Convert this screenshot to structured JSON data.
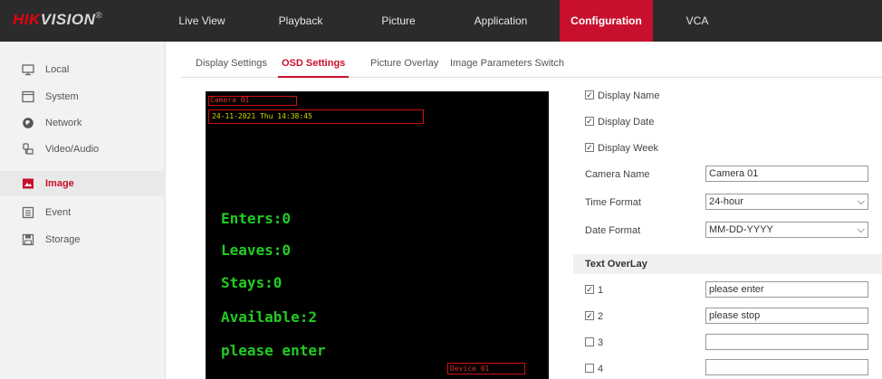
{
  "brand": {
    "part1": "HIK",
    "part2": "VISION",
    "reg": "®"
  },
  "nav": [
    {
      "label": "Live View"
    },
    {
      "label": "Playback"
    },
    {
      "label": "Picture"
    },
    {
      "label": "Application"
    },
    {
      "label": "Configuration",
      "active": true
    },
    {
      "label": "VCA"
    }
  ],
  "sidebar": [
    {
      "label": "Local",
      "icon": "monitor-icon"
    },
    {
      "label": "System",
      "icon": "system-icon"
    },
    {
      "label": "Network",
      "icon": "globe-icon"
    },
    {
      "label": "Video/Audio",
      "icon": "video-audio-icon"
    },
    {
      "label": "Image",
      "icon": "image-icon",
      "active": true
    },
    {
      "label": "Event",
      "icon": "event-icon"
    },
    {
      "label": "Storage",
      "icon": "storage-icon"
    }
  ],
  "tabs": [
    {
      "label": "Display Settings"
    },
    {
      "label": "OSD Settings",
      "active": true
    },
    {
      "label": "Picture Overlay"
    },
    {
      "label": "Image Parameters Switch"
    }
  ],
  "preview": {
    "camera_name": "Camera 01",
    "datetime": "24-11-2021 Thu 14:38:45",
    "device_id": "Device 01",
    "lines": [
      "Enters:0",
      "Leaves:0",
      "Stays:0",
      "Available:2",
      "please enter"
    ]
  },
  "display": {
    "display_name": "Display Name",
    "display_date": "Display Date",
    "display_week": "Display Week"
  },
  "camera_name": {
    "label": "Camera Name",
    "value": "Camera 01"
  },
  "time_format": {
    "label": "Time Format",
    "value": "24-hour"
  },
  "date_format": {
    "label": "Date Format",
    "value": "MM-DD-YYYY"
  },
  "text_overlay": {
    "title": "Text OverLay",
    "items": [
      {
        "num": "1",
        "checked": true,
        "value": "please enter"
      },
      {
        "num": "2",
        "checked": true,
        "value": "please stop"
      },
      {
        "num": "3",
        "checked": false,
        "value": ""
      },
      {
        "num": "4",
        "checked": false,
        "value": ""
      }
    ]
  },
  "colors": {
    "accent": "#c8102e",
    "topbar": "#2b2b2b",
    "osd_text": "#22cc22"
  }
}
